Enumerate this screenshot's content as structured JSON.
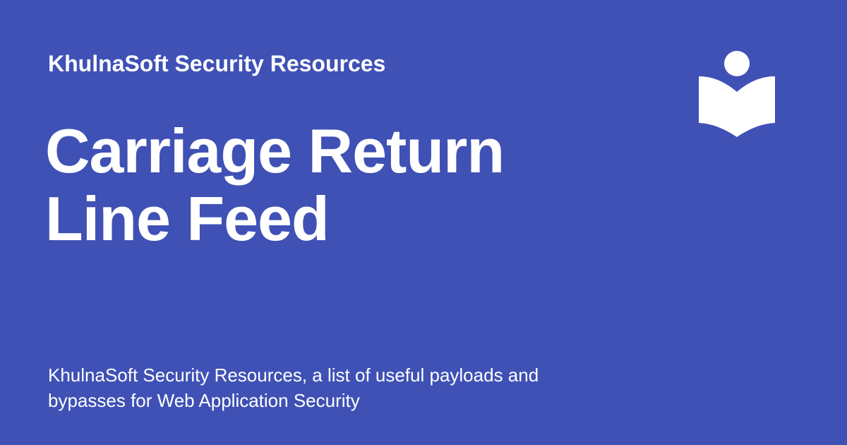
{
  "card": {
    "site_name": "KhulnaSoft Security Resources",
    "title_line_1": "Carriage Return",
    "title_line_2": "Line Feed",
    "description": "KhulnaSoft Security Resources, a list of useful payloads and bypasses for Web Application Security",
    "logo_icon": "open-book-reader-icon"
  },
  "colors": {
    "background": "#3f51b5",
    "text": "#ffffff",
    "logo": "#ffffff"
  }
}
